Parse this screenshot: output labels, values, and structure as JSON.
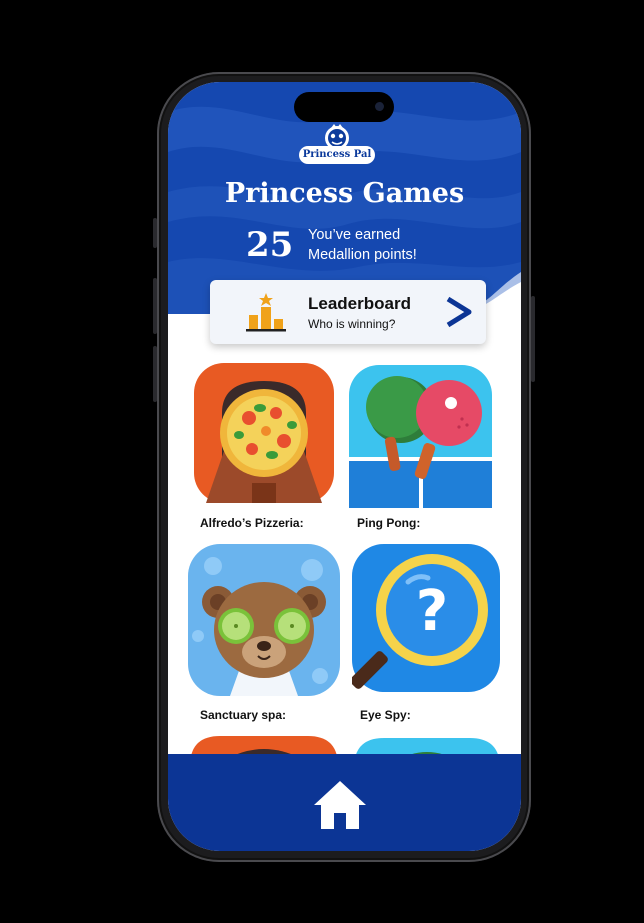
{
  "app": {
    "logo_text": "Princess Pal",
    "title": "Princess Games"
  },
  "points": {
    "value": "25",
    "line1": "You’ve earned",
    "line2": "Medallion points!"
  },
  "leaderboard": {
    "title": "Leaderboard",
    "subtitle": "Who is winning?"
  },
  "games": [
    {
      "label": "Alfredo’s Pizzeria:",
      "icon": "pizza-icon"
    },
    {
      "label": "Ping Pong:",
      "icon": "ping-pong-icon"
    },
    {
      "label": "Sanctuary spa:",
      "icon": "spa-bear-icon"
    },
    {
      "label": "Eye Spy:",
      "icon": "magnifier-question-icon"
    }
  ],
  "colors": {
    "brand_blue": "#0c3595",
    "hero_blue": "#1548b0",
    "wave_blue": "#2a5fc4",
    "accent_orange": "#f0a21a"
  },
  "tabbar": {
    "home_icon": "home-icon"
  }
}
